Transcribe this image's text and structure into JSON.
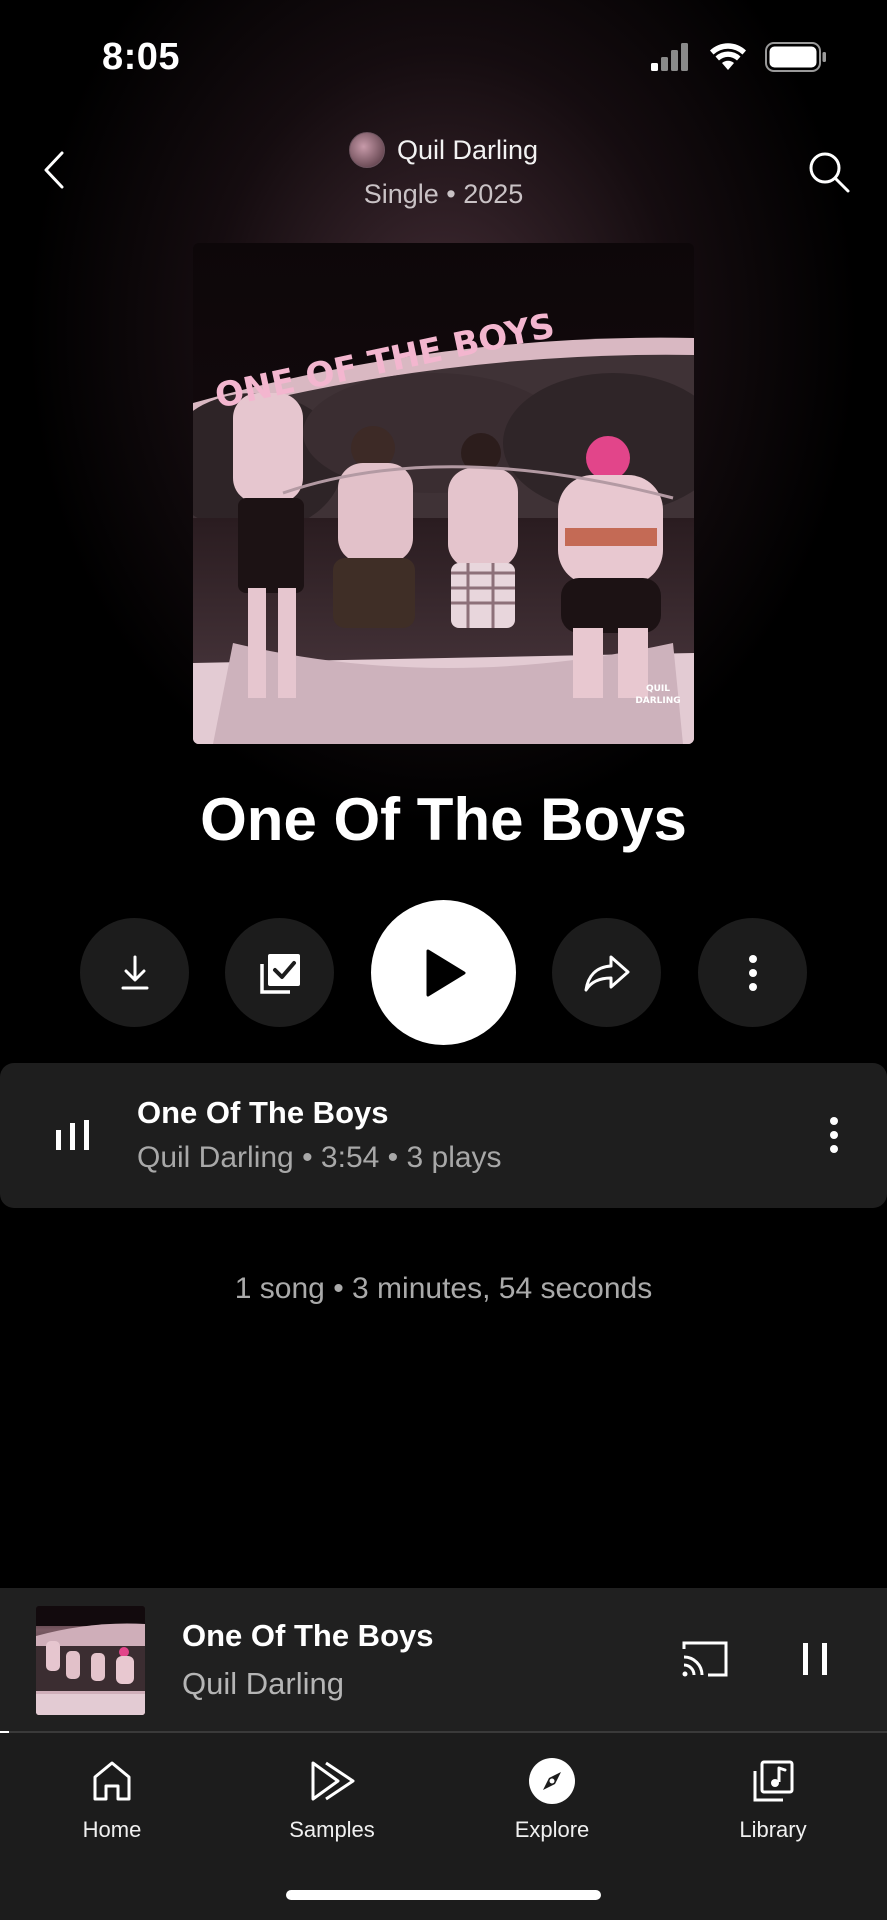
{
  "status_bar": {
    "time": "8:05"
  },
  "header": {
    "artist": "Quil Darling",
    "subtitle": "Single • 2025"
  },
  "cover": {
    "title_text": "ONE OF THE BOYS",
    "corner_text_1": "QUIL",
    "corner_text_2": "DARLING"
  },
  "album": {
    "title": "One Of The Boys"
  },
  "actions": {
    "download": "download-icon",
    "save": "library-check-icon",
    "play": "play-icon",
    "share": "share-icon",
    "more": "more-vertical-icon"
  },
  "track": {
    "title": "One Of The Boys",
    "artist": "Quil Darling",
    "duration": "3:54",
    "plays": "3 plays",
    "separator": " • "
  },
  "summary": "1 song • 3 minutes, 54 seconds",
  "mini_player": {
    "title": "One Of The Boys",
    "artist": "Quil Darling",
    "progress": 0.01
  },
  "nav": {
    "items": [
      {
        "label": "Home",
        "icon": "home-icon"
      },
      {
        "label": "Samples",
        "icon": "samples-icon"
      },
      {
        "label": "Explore",
        "icon": "explore-icon"
      },
      {
        "label": "Library",
        "icon": "library-icon"
      }
    ]
  },
  "colors": {
    "background": "#000000",
    "row": "#1e1e1e",
    "nav": "#1c1c1c",
    "text_secondary": "#a8a8a8"
  }
}
